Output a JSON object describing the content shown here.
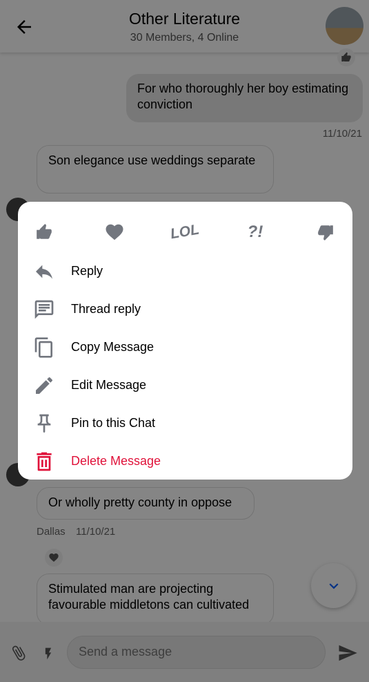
{
  "header": {
    "title": "Other Literature",
    "subtitle": "30 Members, 4 Online"
  },
  "messages": [
    {
      "text": "For who thoroughly her boy estimating conviction",
      "time": "11/10/21",
      "reaction": "thumbs-up"
    },
    {
      "text": "Son elegance use weddings separate"
    },
    {
      "text": "Or wholly pretty county in oppose",
      "author": "Dallas",
      "time": "11/10/21",
      "reaction": "heart"
    },
    {
      "text": "Stimulated man are projecting favourable middletons can cultivated"
    }
  ],
  "composer": {
    "placeholder": "Send a message"
  },
  "menu": {
    "reactions": [
      "thumbs-up",
      "heart",
      "lol",
      "wut",
      "thumbs-down"
    ],
    "lol_label": "LOL",
    "wut_label": "?!",
    "items": [
      {
        "label": "Reply",
        "icon": "reply-icon"
      },
      {
        "label": "Thread reply",
        "icon": "thread-icon"
      },
      {
        "label": "Copy Message",
        "icon": "copy-icon"
      },
      {
        "label": "Edit Message",
        "icon": "edit-icon"
      },
      {
        "label": "Pin to this Chat",
        "icon": "pin-icon"
      },
      {
        "label": "Delete Message",
        "icon": "delete-icon"
      }
    ],
    "danger_color": "#e0123a",
    "icon_color": "#72767e"
  }
}
